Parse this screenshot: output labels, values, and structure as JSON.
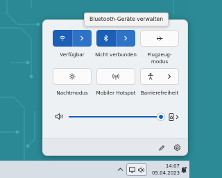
{
  "tooltip": {
    "text": "Bluetooth-Geräte verwalten"
  },
  "tiles": {
    "wifi": {
      "label": "Verfügbar",
      "icon": "wifi-icon",
      "active": true
    },
    "bluetooth": {
      "label": "Nicht verbunden",
      "icon": "bluetooth-icon",
      "active": true
    },
    "airplane": {
      "label": "Flugzeug-",
      "label2": "modus",
      "icon": "airplane-icon",
      "active": false
    },
    "nightlight": {
      "label": "Nachtmodus",
      "icon": "brightness-icon",
      "active": false
    },
    "hotspot": {
      "label": "Mobiler Hotspot",
      "icon": "hotspot-icon",
      "active": false
    },
    "accessibility": {
      "label": "Barrierefreiheit",
      "icon": "accessibility-icon",
      "active": false
    }
  },
  "volume": {
    "level": 0.98,
    "icon": "speaker-icon"
  },
  "footer": {
    "edit_icon": "pencil-icon",
    "settings_icon": "gear-icon"
  },
  "taskbar": {
    "time": "14:07",
    "date": "05.04.2023"
  },
  "colors": {
    "accent": "#1b5fb6",
    "panel": "#eef1f4",
    "taskbar": "#d8dee6"
  }
}
